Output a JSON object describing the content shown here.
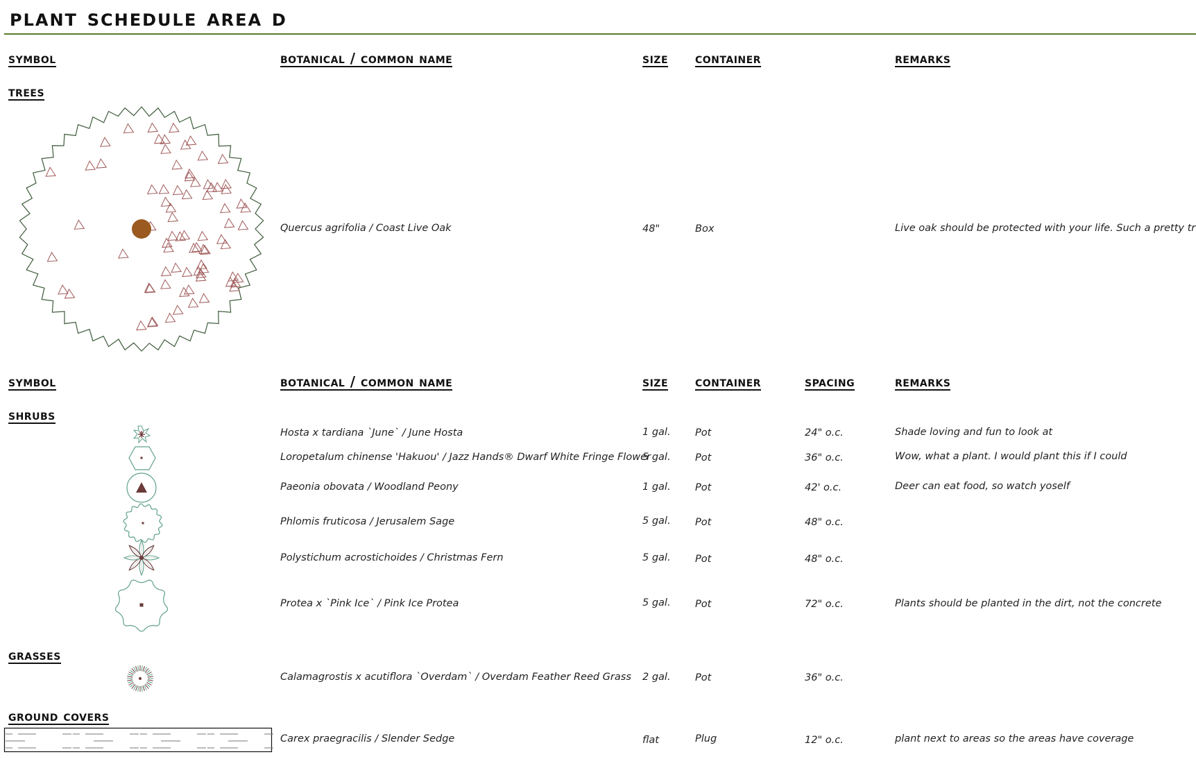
{
  "title": "Plant Schedule Area D",
  "colors": {
    "title_rule": "#5a7a2a",
    "tree_outline": "#3d5a3a",
    "tree_triangles": "#a05a5a",
    "trunk": "#9b5a20",
    "shrub_outline": "#5fa08a",
    "shrub_center": "#6b3a3a"
  },
  "tree_table": {
    "headers": {
      "symbol": "Symbol",
      "name": "Botanical / Common Name",
      "size": "Size",
      "container": "Container",
      "remarks": "Remarks"
    },
    "sections": [
      {
        "label": "Trees",
        "rows": [
          {
            "symbol": "coast-live-oak-symbol",
            "name": "Quercus agrifolia / Coast Live Oak",
            "size": "48\"",
            "container": "Box",
            "remarks": "Live oak should be protected with your life. Such a pretty tree"
          }
        ]
      }
    ]
  },
  "plant_table": {
    "headers": {
      "symbol": "Symbol",
      "name": "Botanical / Common Name",
      "size": "Size",
      "container": "Container",
      "spacing": "Spacing",
      "remarks": "Remarks"
    },
    "sections": [
      {
        "label": "Shrubs",
        "rows": [
          {
            "symbol": "hosta-symbol",
            "name": "Hosta x tardiana `June` / June Hosta",
            "size": "1 gal.",
            "container": "Pot",
            "spacing": "24\" o.c.",
            "remarks": "Shade loving and fun to look at"
          },
          {
            "symbol": "loropetalum-symbol",
            "name": "Loropetalum chinense 'Hakuou' / Jazz Hands® Dwarf White Fringe Flower",
            "size": "5 gal.",
            "container": "Pot",
            "spacing": "36\" o.c.",
            "remarks": "Wow, what a plant. I would plant this if I could"
          },
          {
            "symbol": "peony-symbol",
            "name": "Paeonia obovata / Woodland Peony",
            "size": "1 gal.",
            "container": "Pot",
            "spacing": "42' o.c.",
            "remarks": "Deer can eat food, so watch yoself"
          },
          {
            "symbol": "jerusalem-sage-symbol",
            "name": "Phlomis fruticosa / Jerusalem Sage",
            "size": "5 gal.",
            "container": "Pot",
            "spacing": "48\" o.c.",
            "remarks": ""
          },
          {
            "symbol": "christmas-fern-symbol",
            "name": "Polystichum acrostichoides / Christmas Fern",
            "size": "5 gal.",
            "container": "Pot",
            "spacing": "48\" o.c.",
            "remarks": ""
          },
          {
            "symbol": "protea-symbol",
            "name": "Protea x `Pink Ice` / Pink Ice Protea",
            "size": "5 gal.",
            "container": "Pot",
            "spacing": "72\" o.c.",
            "remarks": "Plants should be planted in the dirt, not the concrete"
          }
        ]
      },
      {
        "label": "Grasses",
        "rows": [
          {
            "symbol": "reed-grass-symbol",
            "name": "Calamagrostis x acutiflora `Overdam` / Overdam Feather Reed Grass",
            "size": "2 gal.",
            "container": "Pot",
            "spacing": "36\" o.c.",
            "remarks": ""
          }
        ]
      },
      {
        "label": "Ground Covers",
        "rows": [
          {
            "symbol": "sedge-hatch-symbol",
            "name": "Carex praegracilis / Slender Sedge",
            "size": "flat",
            "container": "Plug",
            "spacing": "12\" o.c.",
            "remarks": "plant next to areas so the areas have coverage"
          }
        ]
      }
    ]
  }
}
